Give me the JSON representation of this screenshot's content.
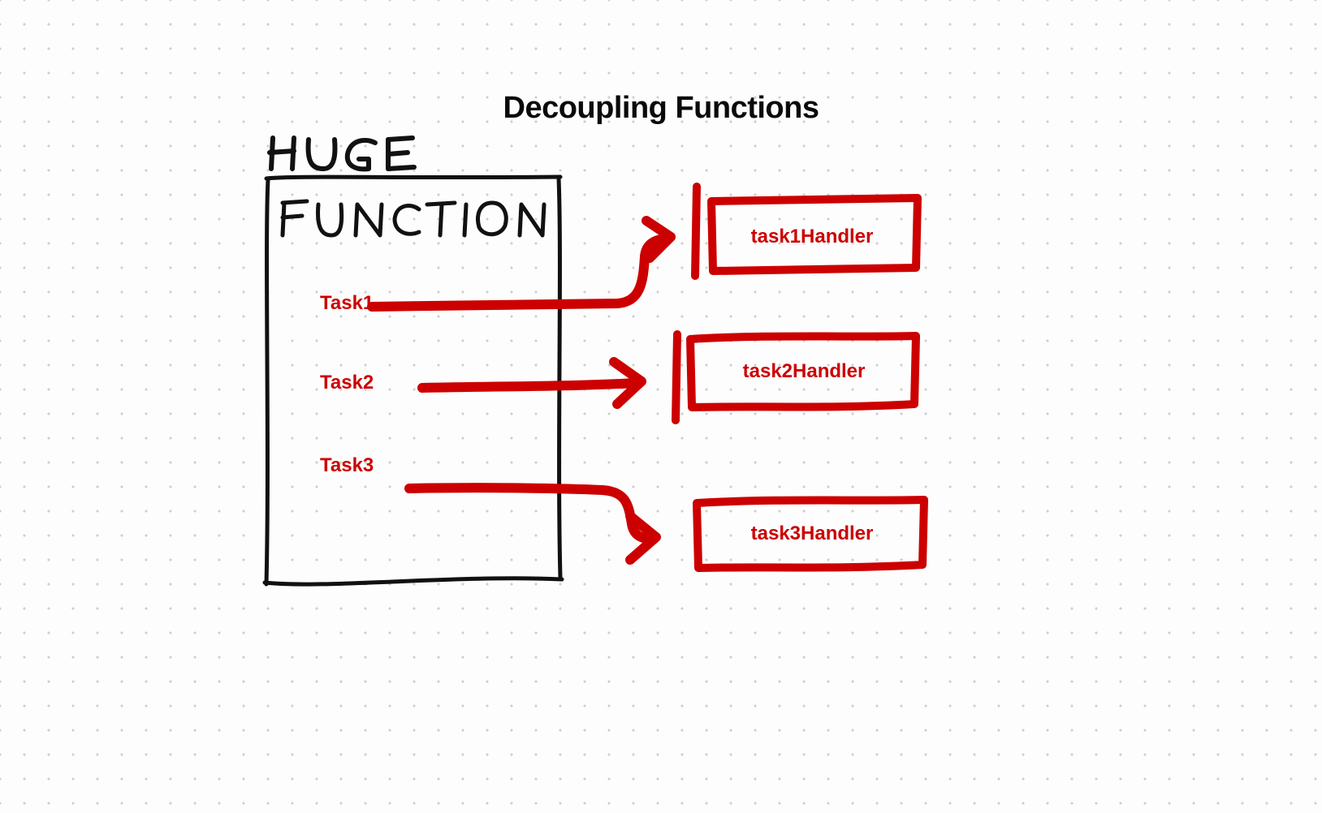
{
  "title": "Decoupling Functions",
  "hugeLabel": {
    "line1": "HUGE",
    "line2": "FUNCTION"
  },
  "tasks": [
    "Task1",
    "Task2",
    "Task3"
  ],
  "handlers": [
    "task1Handler",
    "task2Handler",
    "task3Handler"
  ],
  "colors": {
    "accent": "#cc0000",
    "ink": "#111111"
  }
}
